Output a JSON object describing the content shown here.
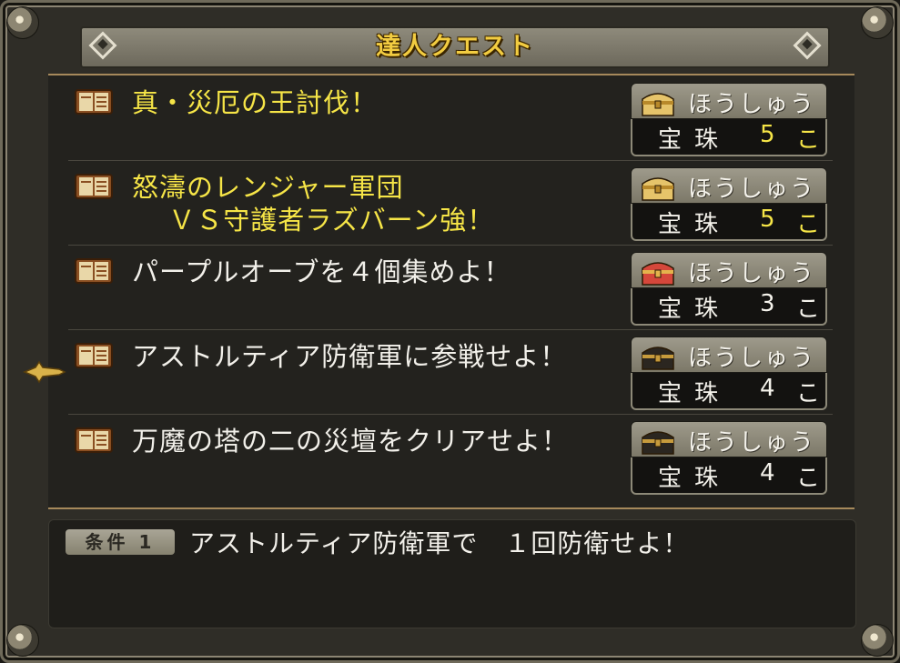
{
  "window": {
    "title": "達人クエスト"
  },
  "reward_header_label": "ほうしゅう",
  "reward_unit": "こ",
  "quests": [
    {
      "lines": "真・災厄の王討伐！",
      "highlight": true,
      "chest": "gold-chest",
      "reward_item": "宝珠",
      "reward_count": "5",
      "count_color": "yellow"
    },
    {
      "lines": "怒濤のレンジャー軍団\n　 ＶＳ守護者ラズバーン強！",
      "highlight": true,
      "chest": "gold-chest",
      "reward_item": "宝珠",
      "reward_count": "5",
      "count_color": "yellow"
    },
    {
      "lines": "パープルオーブを４個集めよ！",
      "highlight": false,
      "chest": "red-chest",
      "reward_item": "宝珠",
      "reward_count": "3",
      "count_color": "white"
    },
    {
      "lines": "アストルティア防衛軍に参戦せよ！",
      "highlight": false,
      "chest": "black-chest",
      "reward_item": "宝珠",
      "reward_count": "4",
      "count_color": "white"
    },
    {
      "lines": "万魔の塔の二の災壇をクリアせよ！",
      "highlight": false,
      "chest": "black-chest",
      "reward_item": "宝珠",
      "reward_count": "4",
      "count_color": "white"
    }
  ],
  "selected_index": 3,
  "condition": {
    "badge": "条件 1",
    "text": "アストルティア防衛軍で　１回防衛せよ！"
  },
  "colors": {
    "title": "#f2cc41",
    "highlight_text": "#f6e547",
    "normal_text": "#f2f0ea"
  }
}
